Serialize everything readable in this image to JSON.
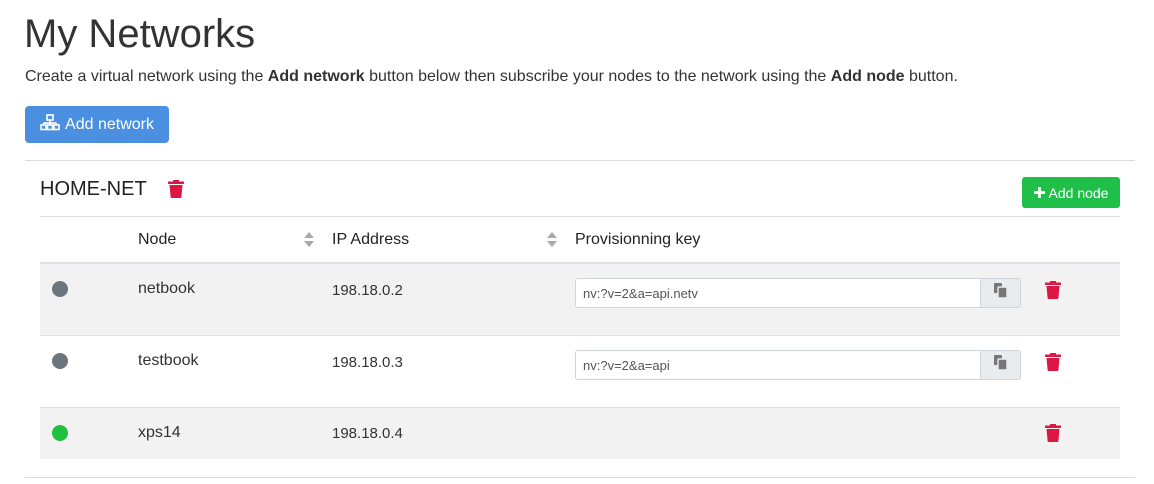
{
  "header": {
    "title": "My Networks",
    "intro_part1": "Create a virtual network using the ",
    "intro_bold1": "Add network",
    "intro_part2": " button below then subscribe your nodes to the network using the ",
    "intro_bold2": "Add node",
    "intro_part3": " button.",
    "add_network_label": "Add network"
  },
  "network": {
    "name": "HOME-NET",
    "add_node_label": "Add node",
    "columns": {
      "node": "Node",
      "ip": "IP Address",
      "key": "Provisionning key"
    },
    "rows": [
      {
        "status": "offline",
        "status_color": "#6c757d",
        "node": "netbook",
        "ip": "198.18.0.2",
        "key": "nv:?v=2&a=api.netv"
      },
      {
        "status": "offline",
        "status_color": "#6c757d",
        "node": "testbook",
        "ip": "198.18.0.3",
        "key": "nv:?v=2&a=api"
      },
      {
        "status": "online",
        "status_color": "#20c040",
        "node": "xps14",
        "ip": "198.18.0.4",
        "key": ""
      }
    ]
  },
  "colors": {
    "primary": "#4a8fe0",
    "success": "#1fbf4a",
    "danger": "#dc1743",
    "muted": "#6c757d"
  }
}
